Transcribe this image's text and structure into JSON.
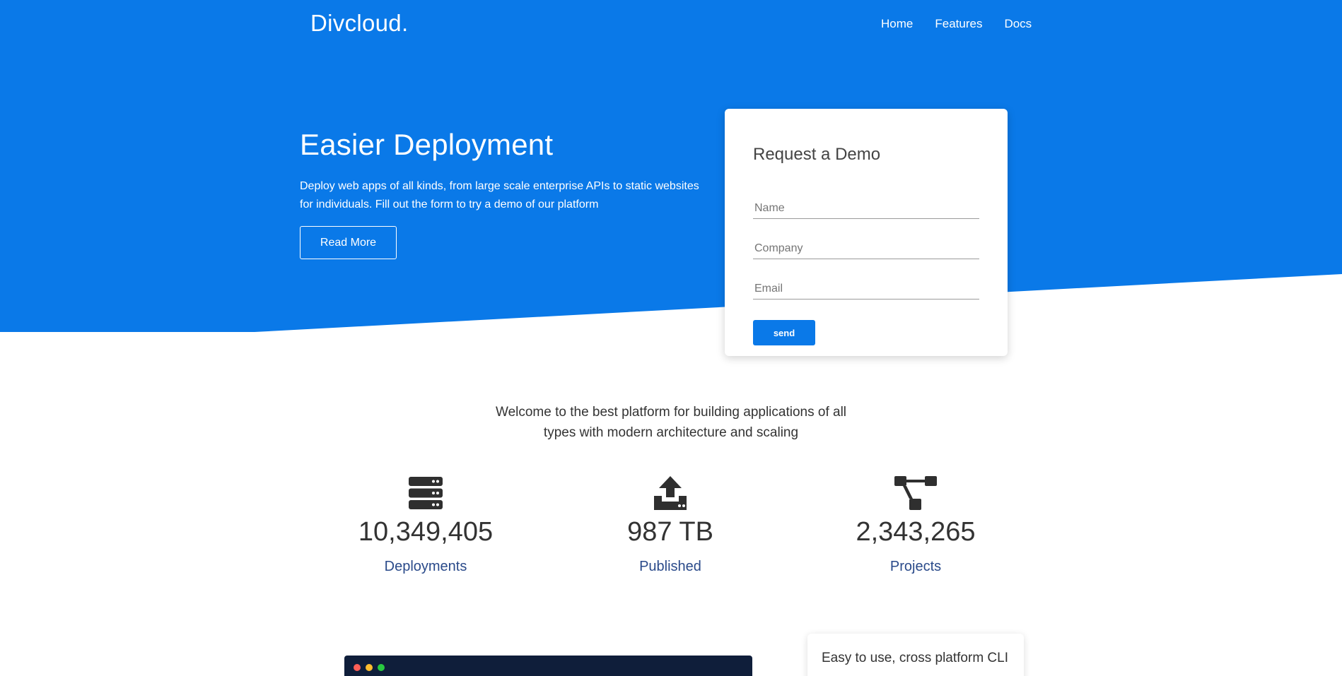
{
  "nav": {
    "logo": "Divcloud.",
    "links": [
      {
        "label": "Home"
      },
      {
        "label": "Features"
      },
      {
        "label": "Docs"
      }
    ]
  },
  "hero": {
    "title": "Easier Deployment",
    "description": "Deploy web apps of all kinds, from large scale enterprise APIs to static websites for individuals. Fill out the form to try a demo of our platform",
    "read_more_label": "Read More"
  },
  "demo_form": {
    "title": "Request a Demo",
    "name_placeholder": "Name",
    "company_placeholder": "Company",
    "email_placeholder": "Email",
    "send_label": "send"
  },
  "welcome": {
    "text": "Welcome to the best platform for building applications of all types with modern architecture and scaling"
  },
  "stats": [
    {
      "icon": "server-icon",
      "value": "10,349,405",
      "label": "Deployments"
    },
    {
      "icon": "upload-icon",
      "value": "987 TB",
      "label": "Published"
    },
    {
      "icon": "project-diagram-icon",
      "value": "2,343,265",
      "label": "Projects"
    }
  ],
  "cli_card": {
    "title": "Easy to use, cross platform CLI"
  },
  "colors": {
    "brand_blue": "#0a79e8",
    "stat_label": "#2a4a8a",
    "terminal_bg": "#0f1e3a"
  }
}
